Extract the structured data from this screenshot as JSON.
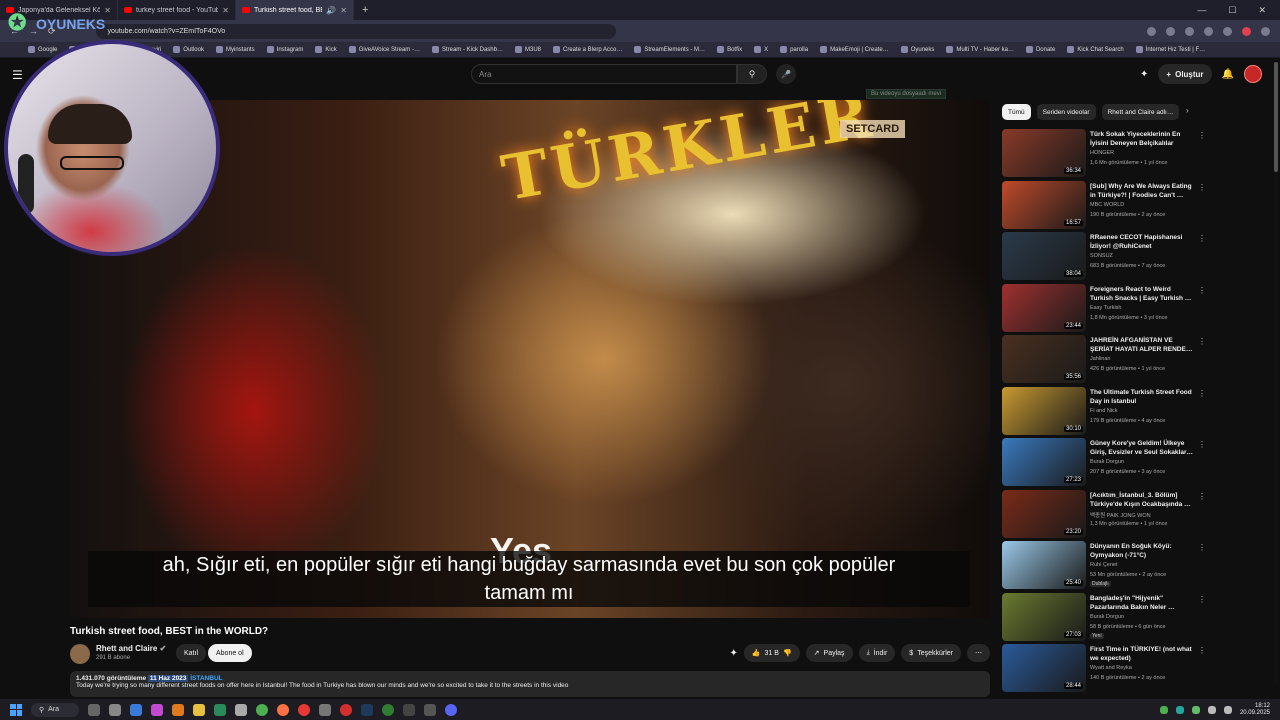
{
  "browser": {
    "tabs": [
      {
        "title": "Japonya'da Geleneksel Köy Hay…",
        "active": false
      },
      {
        "title": "turkey street food - YouTube",
        "active": false
      },
      {
        "title": "Turkish street food, BEST in…",
        "active": true
      }
    ],
    "new_tab": "+",
    "url": "youtube.com/watch?v=ZEmIToF4OVo",
    "bookmarks": [
      "Google",
      "YouTube",
      "Google Çeviri",
      "Outlook",
      "Myinstants",
      "Instagram",
      "Kick",
      "GiveAVoice Stream -…",
      "Stream - Kick Dashb…",
      "M3U8",
      "Create a Blerp Acco…",
      "StreamElements - M…",
      "Botfix",
      "X",
      "parolla",
      "MakeEmoji | Create…",
      "Oyuneks",
      "Multi TV - Haber ka…",
      "Donate",
      "Kick Chat Search",
      "İnternet Hız Testi | F…"
    ]
  },
  "webcam": {
    "logo_text": "OYUNEKS"
  },
  "youtube": {
    "search_placeholder": "Ara",
    "create_label": "Oluştur",
    "saved_flag": "Bu videoyu dosyaadı mevi",
    "video": {
      "sign_text": "TÜRKLER",
      "sign_card": "SETCARD",
      "overlay_word": "Yes",
      "subtitle": "ah, Sığır eti, en popüler sığır eti hangi buğday sarmasında evet bu son çok popüler tamam mı"
    },
    "title": "Turkish street food, BEST in the WORLD?",
    "channel": {
      "name": "Rhett and Claire",
      "subs": "291 B abone",
      "join": "Katıl",
      "subscribe": "Abone ol"
    },
    "actions": {
      "likes": "31 B",
      "share": "Paylaş",
      "download": "İndir",
      "thanks": "Teşekkürler"
    },
    "description": {
      "views": "1.431.070 görüntüleme",
      "date": "11 Haz 2023",
      "tag": "İSTANBUL",
      "text": "Today we're trying so many different street foods on offer here in Istanbul! The food in Turkiye has blown our minds and we're so excited to take it to the streets in this video"
    },
    "chips": [
      {
        "label": "Tümü",
        "active": true
      },
      {
        "label": "Seriden videolar",
        "active": false
      },
      {
        "label": "Rhett and Claire adlı…",
        "active": false
      }
    ],
    "recommendations": [
      {
        "title": "Türk Sokak Yiyeceklerinin En İyisini Deneyen Belçikalılar",
        "channel": "HONGER",
        "meta": "1,6 Mn görüntüleme • 1 yıl önce",
        "duration": "36:34",
        "thumb_color": "#8a3a28",
        "badge": ""
      },
      {
        "title": "[Sub] Why Are We Always Eating in Türkiye?! | Foodies Can't …",
        "channel": "MBC WORLD",
        "meta": "190 B görüntüleme • 2 ay önce",
        "duration": "16:57",
        "thumb_color": "#c04a2a",
        "badge": ""
      },
      {
        "title": "RRaenee CECOT Hapishanesi İzliyor! @RuhiCenet",
        "channel": "SONSUZ",
        "meta": "683 B görüntüleme • 7 ay önce",
        "duration": "38:04",
        "thumb_color": "#2a3a4a",
        "badge": ""
      },
      {
        "title": "Foreigners React to Weird Turkish Snacks | Easy Turkish …",
        "channel": "Easy Turkish",
        "meta": "1,8 Mn görüntüleme • 3 yıl önce",
        "duration": "23:44",
        "thumb_color": "#a03030",
        "badge": ""
      },
      {
        "title": "JAHREİN AFGANİSTAN VE ŞERİAT HAYATI ALPER RENDE…",
        "channel": "Jahlinan",
        "meta": "426 B görüntüleme • 1 yıl önce",
        "duration": "35:56",
        "thumb_color": "#4a3020",
        "badge": ""
      },
      {
        "title": "The Ultimate Turkish Street Food Day in Istanbul",
        "channel": "Fi and Nick",
        "meta": "179 B görüntüleme • 4 ay önce",
        "duration": "30:10",
        "thumb_color": "#c89a30",
        "badge": ""
      },
      {
        "title": "Güney Kore'ye Geldim! Ülkeye Giriş, Evsizler ve Seul Sokaklar…",
        "channel": "Burak Dorgun",
        "meta": "207 B görüntüleme • 3 ay önce",
        "duration": "27:23",
        "thumb_color": "#3a7ac0",
        "badge": ""
      },
      {
        "title": "[Acıktım_İstanbul_3. Bölüm] Türkiye'de Kışın Ocakbaşında …",
        "channel": "백종원 PAIK JONG WON",
        "meta": "1,3 Mn görüntüleme • 1 yıl önce",
        "duration": "23:20",
        "thumb_color": "#7a2a18",
        "badge": ""
      },
      {
        "title": "Dünyanın En Soğuk Köyü: Oymyakon (-71°C)",
        "channel": "Ruhi Çenet",
        "meta": "53 Mn görüntüleme • 2 ay önce",
        "duration": "25:40",
        "thumb_color": "#9ac8e8",
        "badge": "Dublajlı"
      },
      {
        "title": "Bangladeş'in \"Hijyenik\" Pazarlarında Bakın Neler …",
        "channel": "Burak Dorgun",
        "meta": "58 B görüntüleme • 6 gün önce",
        "duration": "27:03",
        "thumb_color": "#6a7a30",
        "badge": "Yeni"
      },
      {
        "title": "First Time in TÜRKIYE! (not what we expected)",
        "channel": "Wyatt and Reyka",
        "meta": "140 B görüntüleme • 2 ay önce",
        "duration": "28:44",
        "thumb_color": "#2a5a9a",
        "badge": ""
      }
    ]
  },
  "taskbar": {
    "search_label": "Ara",
    "time": "18:12",
    "date": "20.09.2025"
  }
}
